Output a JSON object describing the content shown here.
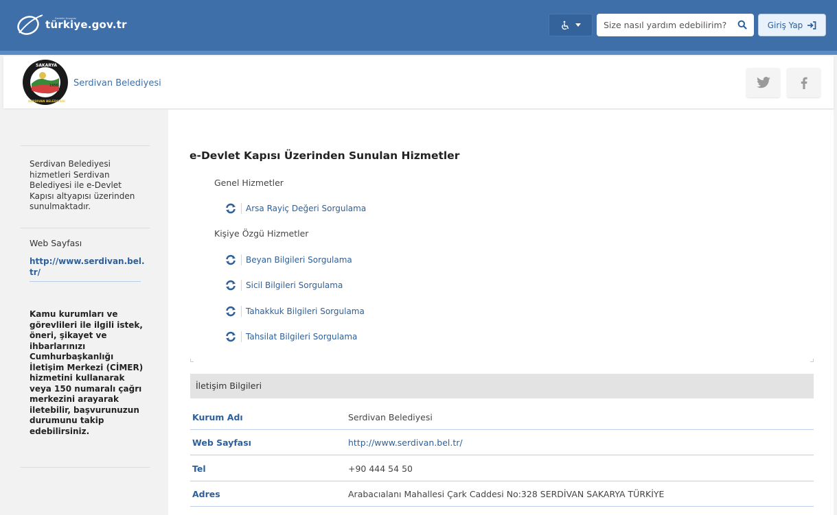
{
  "header": {
    "logo_text": "türkiye.gov.tr",
    "logo_subtext": "Devletin Kısayolu",
    "search_placeholder": "Size nasıl yardım edebilirim?",
    "login_label": "Giriş Yap",
    "accessibility_icon": "wheelchair-icon"
  },
  "institution": {
    "name": "Serdivan Belediyesi",
    "seal_top_text": "SAKARYA",
    "seal_bottom_text": "SERDIVAN BELEDIYESI",
    "seal_year": "1956",
    "social": [
      "twitter-icon",
      "facebook-icon"
    ]
  },
  "sidebar": {
    "description": "Serdivan Belediyesi hizmetleri Serdivan Belediyesi ile e-Devlet Kapısı altyapısı üzerinden sunulmaktadır.",
    "web_label": "Web Sayfası",
    "web_link": "http://www.serdivan.bel.tr/",
    "cimer_text": "Kamu kurumları ve görevlileri ile ilgili istek, öneri, şikayet ve ihbarlarınızı Cumhurbaşkanlığı İletişim Merkezi (CİMER) hizmetini kullanarak veya 150 numaralı çağrı merkezini arayarak iletebilir, başvurunuzun durumunu takip edebilirsiniz."
  },
  "main": {
    "title": "e-Devlet Kapısı Üzerinden Sunulan Hizmetler",
    "groups": [
      {
        "label": "Genel Hizmetler",
        "services": [
          "Arsa Rayiç Değeri Sorgulama"
        ]
      },
      {
        "label": "Kişiye Özgü Hizmetler",
        "services": [
          "Beyan Bilgileri Sorgulama",
          "Sicil Bilgileri Sorgulama",
          "Tahakkuk Bilgileri Sorgulama",
          "Tahsilat Bilgileri Sorgulama"
        ]
      }
    ]
  },
  "contact": {
    "heading": "İletişim Bilgileri",
    "rows": [
      {
        "key": "Kurum Adı",
        "value": "Serdivan Belediyesi"
      },
      {
        "key": "Web Sayfası",
        "value": "http://www.serdivan.bel.tr/"
      },
      {
        "key": "Tel",
        "value": "+90 444 54 50"
      },
      {
        "key": "Adres",
        "value": "Arabacıalanı Mahallesi Çark Caddesi No:328 SERDİVAN SAKARYA TÜRKİYE"
      }
    ]
  },
  "colors": {
    "brand": "#3f6fa8",
    "link": "#2d5f9a"
  }
}
